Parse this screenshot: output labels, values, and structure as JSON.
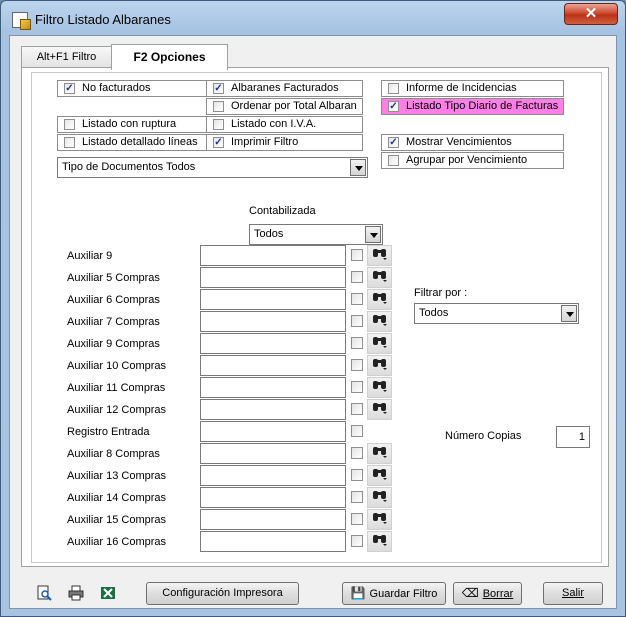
{
  "window": {
    "title": "Filtro Listado Albaranes",
    "close_glyph": "✕"
  },
  "tabs": [
    {
      "label": "Alt+F1 Filtro"
    },
    {
      "label": "F2 Opciones"
    }
  ],
  "options": {
    "no_facturados": {
      "label": "No facturados",
      "checked": "✓"
    },
    "albaranes_facturados": {
      "label": "Albaranes Facturados",
      "checked": "✓"
    },
    "ordenar_total": {
      "label": "Ordenar por Total Albaran",
      "checked": ""
    },
    "listado_ruptura": {
      "label": "Listado con ruptura",
      "checked": ""
    },
    "listado_iva": {
      "label": "Listado con I.V.A.",
      "checked": ""
    },
    "listado_detallado": {
      "label": "Listado detallado líneas",
      "checked": ""
    },
    "imprimir_filtro": {
      "label": "Imprimir Filtro",
      "checked": "✓"
    },
    "informe_incidencias": {
      "label": "Informe de Incidencias",
      "checked": ""
    },
    "listado_tipo_diario": {
      "label": "Listado Tipo Diario de Facturas",
      "checked": "✓"
    },
    "mostrar_vencimientos": {
      "label": "Mostrar Vencimientos",
      "checked": "✓"
    },
    "agrupar_vencimiento": {
      "label": "Agrupar por Vencimiento",
      "checked": ""
    }
  },
  "tipo_documentos": {
    "value": "Tipo de Documentos Todos"
  },
  "contabilizada": {
    "label": "Contabilizada",
    "value": "Todos"
  },
  "filtrar_por": {
    "label": "Filtrar por :",
    "value": "Todos"
  },
  "numero_copias": {
    "label": "Número Copias",
    "value": "1"
  },
  "aux_rows": [
    {
      "label": "Auxiliar 9",
      "value": ""
    },
    {
      "label": "Auxiliar 5 Compras",
      "value": ""
    },
    {
      "label": "Auxiliar 6 Compras",
      "value": ""
    },
    {
      "label": "Auxiliar 7 Compras",
      "value": ""
    },
    {
      "label": "Auxiliar 9 Compras",
      "value": ""
    },
    {
      "label": "Auxiliar 10 Compras",
      "value": ""
    },
    {
      "label": "Auxiliar 11 Compras",
      "value": ""
    },
    {
      "label": "Auxiliar 12 Compras",
      "value": ""
    },
    {
      "label": "Registro Entrada",
      "value": ""
    },
    {
      "label": "Auxiliar 8 Compras",
      "value": ""
    },
    {
      "label": "Auxiliar 13 Compras",
      "value": ""
    },
    {
      "label": "Auxiliar 14 Compras",
      "value": ""
    },
    {
      "label": "Auxiliar 15 Compras",
      "value": ""
    },
    {
      "label": "Auxiliar 16 Compras",
      "value": ""
    }
  ],
  "icons": {
    "find": "binoculars-icon",
    "preview": "print-preview-icon",
    "printer": "printer-icon",
    "excel": "excel-icon"
  },
  "buttons": {
    "config": "Configuración Impresora",
    "guardar_filtro": "Guardar Filtro",
    "borrar": "Borrar",
    "salir": "Salir"
  },
  "colors": {
    "highlight": "#ff7fe6",
    "title_bar": "#a9c4e1",
    "close_button": "#cf4b30"
  }
}
